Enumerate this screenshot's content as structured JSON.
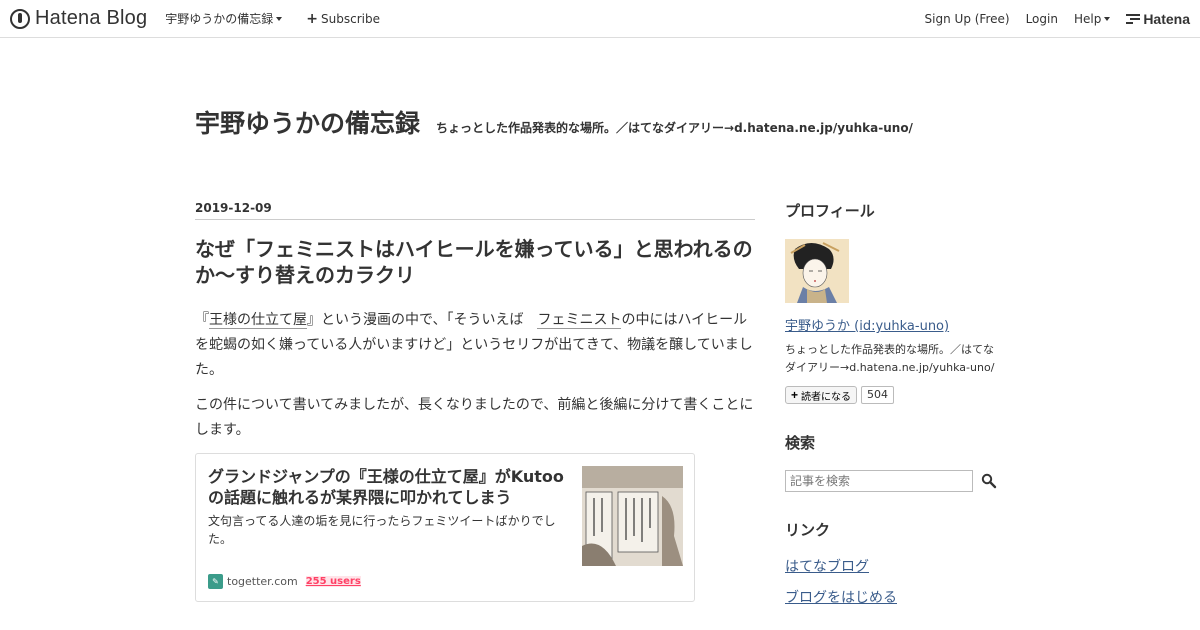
{
  "globalbar": {
    "logo_text": "Hatena Blog",
    "blog_menu": "宇野ゆうかの備忘録",
    "subscribe": "Subscribe",
    "signup": "Sign Up (Free)",
    "login": "Login",
    "help": "Help",
    "hatena": "Hatena"
  },
  "header": {
    "title": "宇野ゆうかの備忘録",
    "description": "ちょっとした作品発表的な場所。／はてなダイアリー→d.hatena.ne.jp/yuhka-uno/"
  },
  "entry": {
    "date": "2019-12-09",
    "title": "なぜ「フェミニストはハイヒールを嫌っている」と思われるのか～すり替えのカラクリ",
    "p1_a": "『",
    "p1_kw1": "王様の仕立て屋",
    "p1_b": "』という漫画の中で、「そういえば　",
    "p1_kw2": "フェミニスト",
    "p1_c": "の中にはハイヒールを蛇蝎の如く嫌っている人がいますけど」というセリフが出てきて、物議を醸していました。",
    "p2": "この件について書いてみましたが、長くなりましたので、前編と後編に分けて書くことにします。",
    "embed": {
      "title": "グランドジャンプの『王様の仕立て屋』がKutooの話題に触れるが某界隈に叩かれてしまう",
      "description": "文句言ってる人達の垢を見に行ったらフェミツイートばかりでした。",
      "site": "togetter.com",
      "users": "255 users"
    }
  },
  "sidebar": {
    "profile_heading": "プロフィール",
    "profile_name": "宇野ゆうか (id:yuhka-uno)",
    "profile_desc": "ちょっとした作品発表的な場所。／はてなダイアリー→d.hatena.ne.jp/yuhka-uno/",
    "reader_button": "読者になる",
    "reader_count": "504",
    "search_heading": "検索",
    "search_placeholder": "記事を検索",
    "links_heading": "リンク",
    "links": [
      "はてなブログ",
      "ブログをはじめる"
    ]
  }
}
